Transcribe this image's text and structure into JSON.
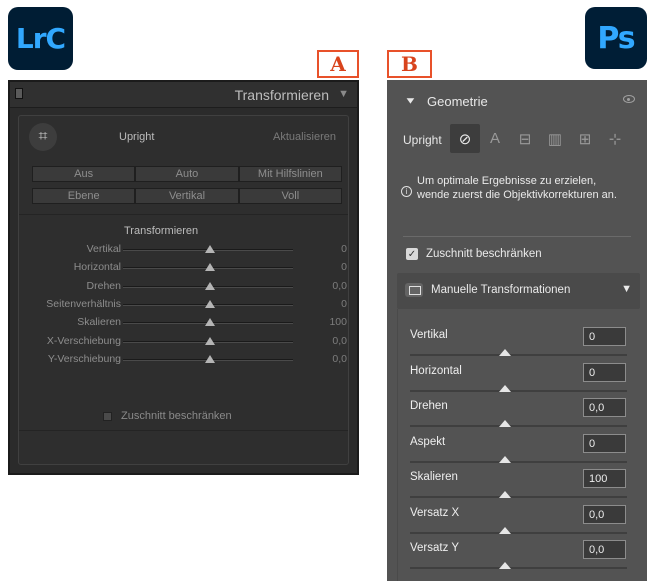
{
  "logos": {
    "lrc": "LrC",
    "ps": "Ps"
  },
  "markers": {
    "a": "A",
    "b": "B"
  },
  "lrc": {
    "title": "Transformieren",
    "upright_label": "Upright",
    "update_button": "Aktualisieren",
    "buttons": [
      "Aus",
      "Auto",
      "Mit Hilfslinien",
      "Ebene",
      "Vertikal",
      "Voll"
    ],
    "section_label": "Transformieren",
    "sliders": [
      {
        "label": "Vertikal",
        "value": "0"
      },
      {
        "label": "Horizontal",
        "value": "0"
      },
      {
        "label": "Drehen",
        "value": "0,0"
      },
      {
        "label": "Seitenverhältnis",
        "value": "0"
      },
      {
        "label": "Skalieren",
        "value": "100"
      },
      {
        "label": "X-Verschiebung",
        "value": "0,0"
      },
      {
        "label": "Y-Verschiebung",
        "value": "0,0"
      }
    ],
    "constrain_label": "Zuschnitt beschränken",
    "constrain_checked": false
  },
  "ps": {
    "section_title": "Geometrie",
    "upright_label": "Upright",
    "upright_icons": [
      "off-icon",
      "auto-icon",
      "level-icon",
      "vertical-icon",
      "full-icon",
      "guided-icon"
    ],
    "upright_glyphs": [
      "⊘",
      "A",
      "⊟",
      "▥",
      "⊞",
      "⊹"
    ],
    "info_text": "Um optimale Ergebnisse zu erzielen, wende zuerst die Objektivkorrekturen an.",
    "constrain_label": "Zuschnitt beschränken",
    "constrain_checked": true,
    "manual_label": "Manuelle Transformationen",
    "fields": [
      {
        "label": "Vertikal",
        "value": "0"
      },
      {
        "label": "Horizontal",
        "value": "0"
      },
      {
        "label": "Drehen",
        "value": "0,0"
      },
      {
        "label": "Aspekt",
        "value": "0"
      },
      {
        "label": "Skalieren",
        "value": "100"
      },
      {
        "label": "Versatz X",
        "value": "0,0"
      },
      {
        "label": "Versatz Y",
        "value": "0,0"
      }
    ]
  },
  "colors": {
    "accent_marker": "#e8512a",
    "ps_brand": "#31a8ff",
    "ps_bg": "#001e36"
  }
}
